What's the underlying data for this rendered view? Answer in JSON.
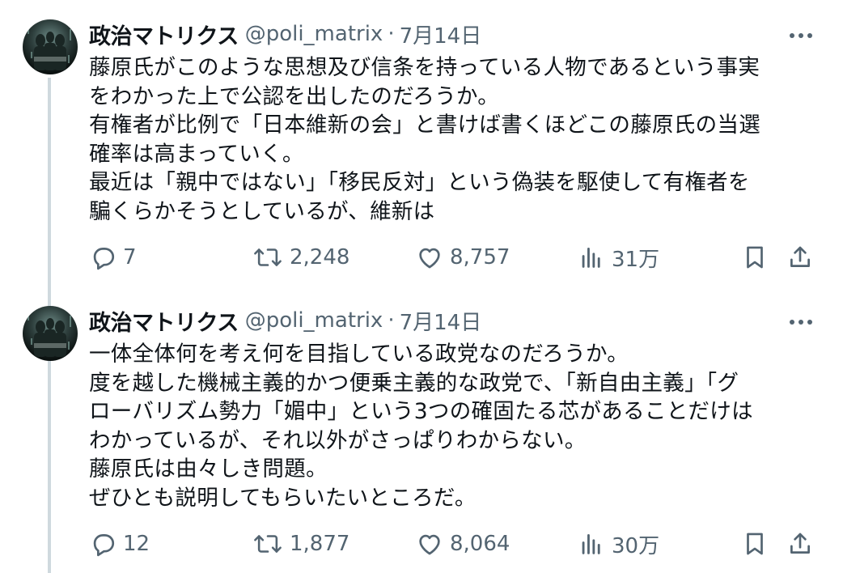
{
  "tweets": [
    {
      "author": {
        "name": "政治マトリクス",
        "handle": "@poli_matrix"
      },
      "separator": "·",
      "date": "7月14日",
      "lines": [
        "藤原氏がこのような思想及び信条を持っている人物であるという事実",
        "をわかった上で公認を出したのだろうか。",
        "有権者が比例で「日本維新の会」と書けば書くほどこの藤原氏の当選",
        "確率は高まっていく。",
        "最近は「親中ではない」「移民反対」という偽装を駆使して有権者を",
        "騙くらかそうとしているが、維新は"
      ],
      "stats": {
        "replies": "7",
        "retweets": "2,248",
        "likes": "8,757",
        "views": "31万"
      }
    },
    {
      "author": {
        "name": "政治マトリクス",
        "handle": "@poli_matrix"
      },
      "separator": "·",
      "date": "7月14日",
      "lines": [
        "一体全体何を考え何を目指している政党なのだろうか。",
        "度を越した機械主義的かつ便乗主義的な政党で、「新自由主義」「グ",
        "ローバリズム勢力「媚中」という3つの確固たる芯があることだけは",
        "わかっているが、それ以外がさっぱりわからない。",
        "藤原氏は由々しき問題。",
        "ぜひとも説明してもらいたいところだ。"
      ],
      "stats": {
        "replies": "12",
        "retweets": "1,877",
        "likes": "8,064",
        "views": "30万"
      }
    }
  ],
  "icons": {
    "avatar": "matrix-avatar-icon",
    "more": "more-icon",
    "reply": "reply-icon",
    "retweet": "retweet-icon",
    "like": "like-icon",
    "views": "views-icon",
    "bookmark": "bookmark-icon",
    "share": "share-icon"
  },
  "colors": {
    "text": "#0f1419",
    "secondary": "#536471",
    "thread_line": "#cfd9de"
  }
}
